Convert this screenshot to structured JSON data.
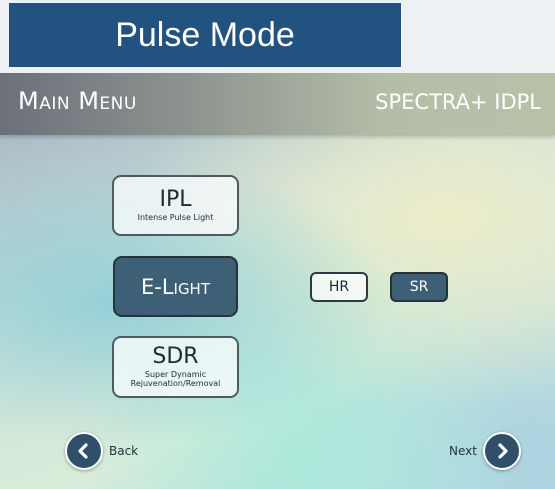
{
  "banner": {
    "title": "Pulse Mode"
  },
  "header": {
    "menu_title": "Main Menu",
    "product": "SPECTRA+ IDPL"
  },
  "modes": {
    "ipl": {
      "label": "IPL",
      "sublabel": "Intense Pulse Light",
      "selected": false
    },
    "elight": {
      "label": "E-Light",
      "selected": true
    },
    "sdr": {
      "label": "SDR",
      "sublabel_line1": "Super Dynamic",
      "sublabel_line2": "Rejuvenation/Removal",
      "selected": false
    }
  },
  "submodes": {
    "hr": {
      "label": "HR",
      "selected": false
    },
    "sr": {
      "label": "SR",
      "selected": true
    }
  },
  "nav": {
    "back_label": "Back",
    "next_label": "Next"
  },
  "icons": {
    "back": "chevron-left-icon",
    "next": "chevron-right-icon"
  },
  "colors": {
    "banner": "#22527f",
    "selected_button": "#3e6076",
    "nav_circle": "#304f6a"
  }
}
